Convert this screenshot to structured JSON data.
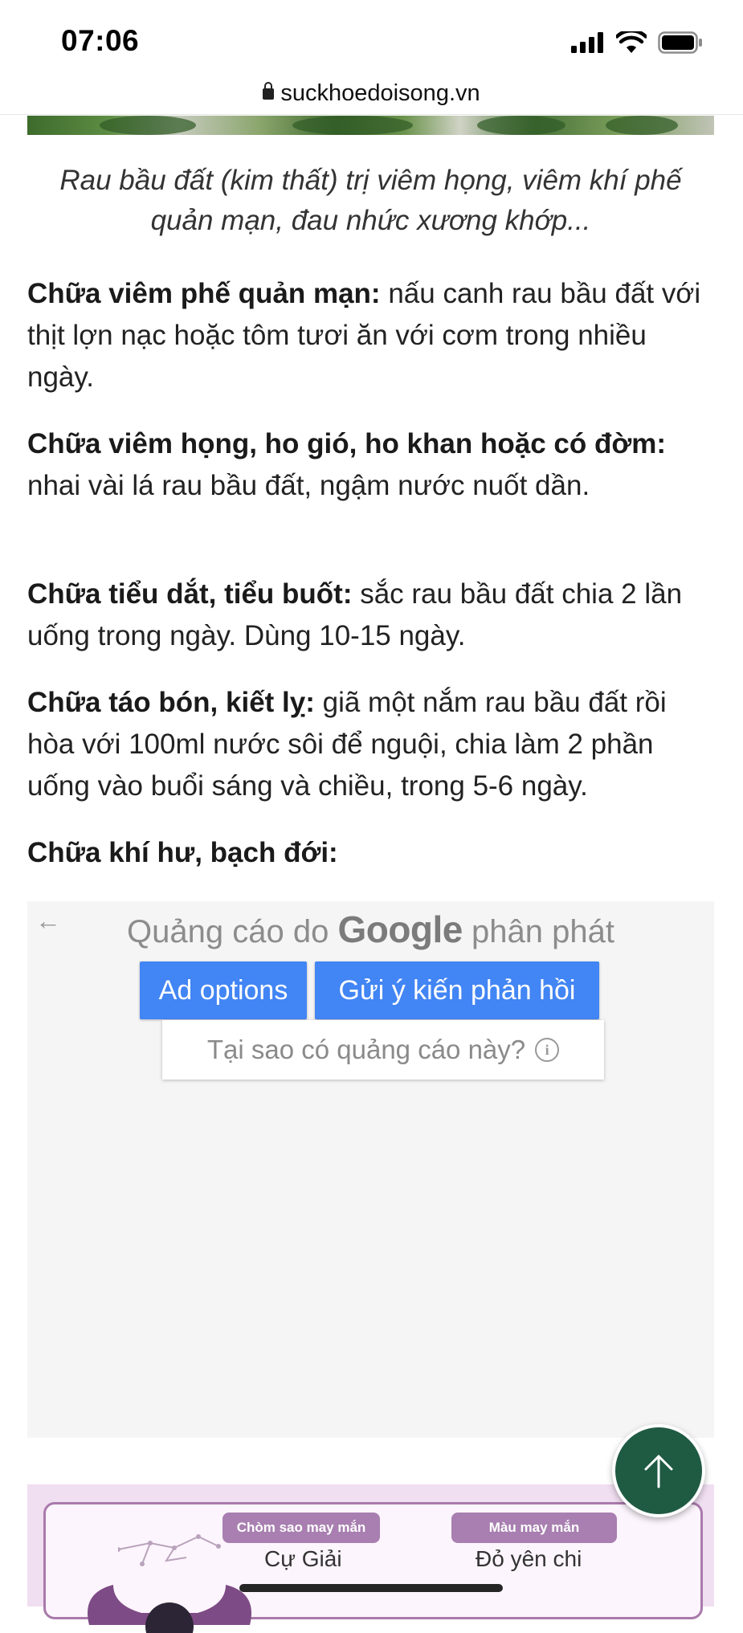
{
  "status": {
    "time": "07:06"
  },
  "browser": {
    "url": "suckhoedoisong.vn"
  },
  "article": {
    "caption": "Rau bầu đất (kim thất) trị viêm họng, viêm khí phế quản mạn, đau nhức xương khớp...",
    "sections": [
      {
        "title": "Chữa viêm phế quản mạn:",
        "text": " nấu canh rau bầu đất với thịt lợn nạc hoặc tôm tươi ăn với cơm trong nhiều ngày."
      },
      {
        "title": "Chữa viêm họng, ho gió, ho khan hoặc có đờm:",
        "text": " nhai vài lá rau bầu đất, ngậm nước nuốt dần."
      },
      {
        "title": "Chữa tiểu dắt, tiểu buốt:",
        "text": " sắc rau bầu đất chia 2 lần uống trong ngày. Dùng 10-15 ngày."
      },
      {
        "title": "Chữa táo bón, kiết lỵ:",
        "text": " giã một nắm rau bầu đất rồi hòa với 100ml nước sôi để nguội, chia làm 2 phần uống vào buổi sáng và chiều, trong 5-6 ngày."
      },
      {
        "title": "Chữa khí hư, bạch đới:",
        "text": ""
      }
    ]
  },
  "ad": {
    "back_label": "←",
    "prefix": "Quảng cáo do",
    "brand": "Google",
    "suffix": "phân phát",
    "options_label": "Ad options",
    "feedback_label": "Gửi ý kiến phản hồi",
    "why_label": "Tại sao có quảng cáo này?",
    "info_symbol": "i"
  },
  "widget": {
    "constellation_label": "Chòm sao may mắn",
    "constellation_value": "Cự Giải",
    "color_label": "Màu may mắn",
    "color_value": "Đỏ yên chi"
  },
  "colors": {
    "ad_button": "#4285f4",
    "scroll_top": "#1f5a43",
    "widget_accent": "#a87fb0"
  },
  "icons": [
    "signal-icon",
    "wifi-icon",
    "battery-icon",
    "lock-icon",
    "back-arrow-icon",
    "info-icon",
    "arrow-up-icon",
    "constellation-icon",
    "horns-icon"
  ]
}
